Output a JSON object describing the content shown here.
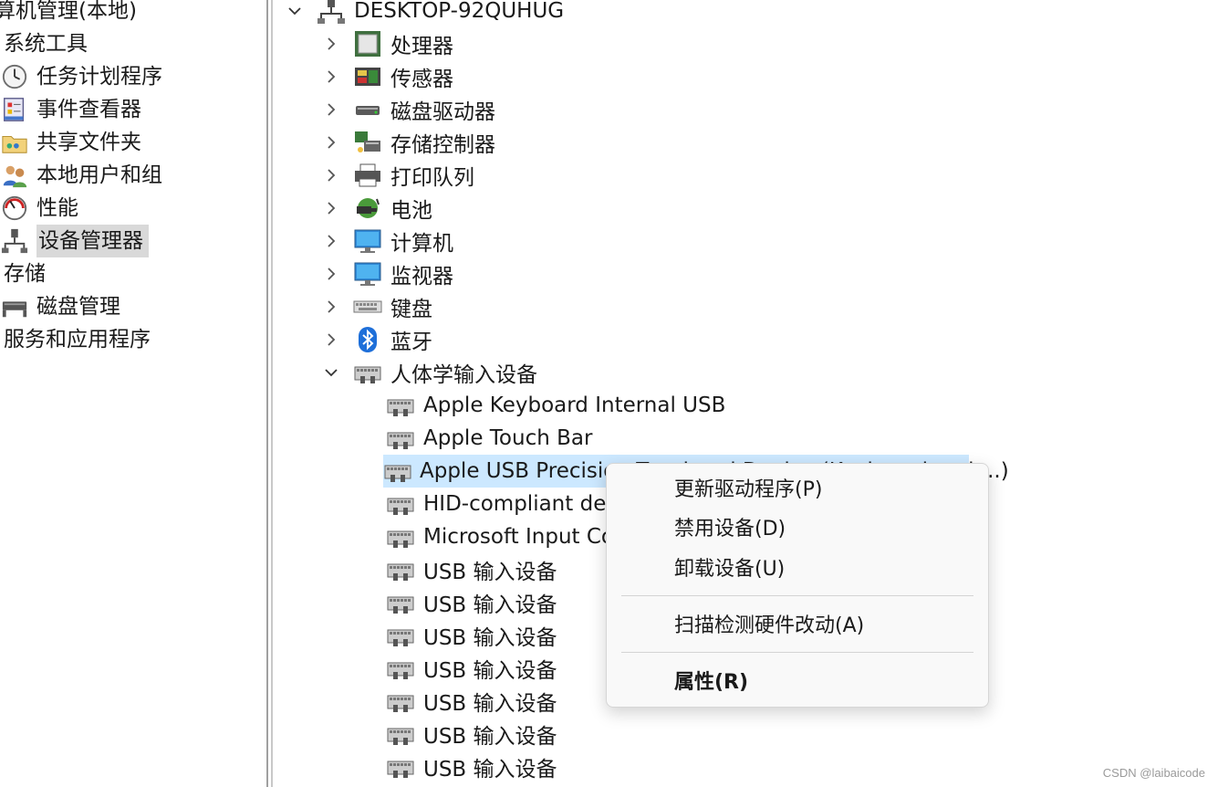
{
  "left_nav": {
    "root_label": "算机管理(本地)",
    "items": [
      {
        "label": "系统工具",
        "icon": "none",
        "indent": 0
      },
      {
        "label": "任务计划程序",
        "icon": "clock-icon",
        "indent": 1
      },
      {
        "label": "事件查看器",
        "icon": "event-log-icon",
        "indent": 1
      },
      {
        "label": "共享文件夹",
        "icon": "shared-folder-icon",
        "indent": 1
      },
      {
        "label": "本地用户和组",
        "icon": "users-icon",
        "indent": 1
      },
      {
        "label": "性能",
        "icon": "performance-gauge-icon",
        "indent": 1
      },
      {
        "label": "设备管理器",
        "icon": "device-manager-icon",
        "indent": 1,
        "selected": true
      },
      {
        "label": "存储",
        "icon": "none",
        "indent": 0
      },
      {
        "label": "磁盘管理",
        "icon": "disk-management-icon",
        "indent": 1
      },
      {
        "label": "服务和应用程序",
        "icon": "none",
        "indent": 0
      }
    ]
  },
  "tree": {
    "root": {
      "label": "DESKTOP-92QUHUG",
      "icon": "computer-tower-icon",
      "expanded": true
    },
    "categories": [
      {
        "label": "处理器",
        "icon": "processor-icon"
      },
      {
        "label": "传感器",
        "icon": "sensor-icon"
      },
      {
        "label": "磁盘驱动器",
        "icon": "disk-drive-icon"
      },
      {
        "label": "存储控制器",
        "icon": "storage-controller-icon"
      },
      {
        "label": "打印队列",
        "icon": "printer-icon"
      },
      {
        "label": "电池",
        "icon": "battery-icon"
      },
      {
        "label": "计算机",
        "icon": "monitor-icon"
      },
      {
        "label": "监视器",
        "icon": "monitor-icon"
      },
      {
        "label": "键盘",
        "icon": "keyboard-icon"
      },
      {
        "label": "蓝牙",
        "icon": "bluetooth-icon"
      },
      {
        "label": "人体学输入设备",
        "icon": "hid-icon",
        "expanded": true
      }
    ],
    "hid_children": [
      {
        "label": "Apple Keyboard Internal USB"
      },
      {
        "label": "Apple Touch Bar"
      },
      {
        "label": "Apple USB Precision Touchpad Device (Keyboard and ...)",
        "selected": true,
        "visible_text": "Apple USB Precisio"
      },
      {
        "label": "HID-compliant dev",
        "visible_text": "HID-compliant dev"
      },
      {
        "label": "Microsoft Input Co",
        "visible_text": "Microsoft Input Co"
      },
      {
        "label": "USB 输入设备"
      },
      {
        "label": "USB 输入设备"
      },
      {
        "label": "USB 输入设备"
      },
      {
        "label": "USB 输入设备"
      },
      {
        "label": "USB 输入设备"
      },
      {
        "label": "USB 输入设备"
      },
      {
        "label": "USB 输入设备"
      }
    ]
  },
  "context_menu": {
    "items": [
      {
        "label": "更新驱动程序(P)"
      },
      {
        "label": "禁用设备(D)"
      },
      {
        "label": "卸载设备(U)"
      },
      {
        "label": "扫描检测硬件改动(A)"
      },
      {
        "label": "属性(R)",
        "bold": true
      }
    ]
  },
  "watermark": "CSDN @laibaicode",
  "colors": {
    "selection_blue": "#cce8ff",
    "nav_selected_gray": "#d9d9d9",
    "menu_bg": "#f9f9f9"
  }
}
